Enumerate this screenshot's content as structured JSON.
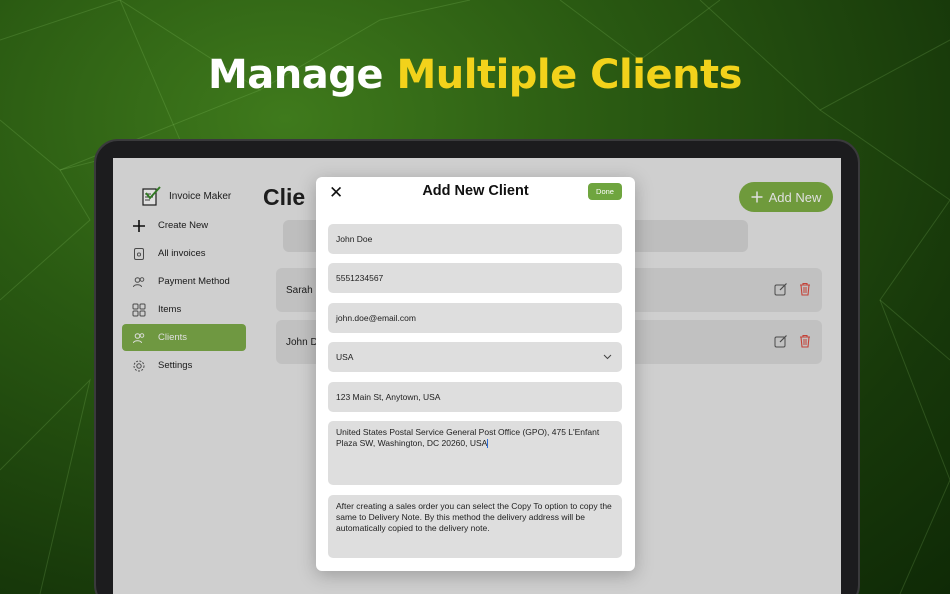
{
  "headline": {
    "part1": "Manage",
    "part2": "Multiple Clients"
  },
  "app": {
    "name": "Invoice Maker"
  },
  "sidebar": {
    "items": [
      {
        "label": "Create New",
        "icon": "plus-icon"
      },
      {
        "label": "All invoices",
        "icon": "document-icon"
      },
      {
        "label": "Payment Method",
        "icon": "users-icon"
      },
      {
        "label": "Items",
        "icon": "grid-icon"
      },
      {
        "label": "Clients",
        "icon": "users-icon",
        "active": true
      },
      {
        "label": "Settings",
        "icon": "gear-icon"
      }
    ]
  },
  "main": {
    "title": "Clie",
    "add_button": "Add New",
    "clients": [
      {
        "name": "Sarah "
      },
      {
        "name": "John D"
      }
    ]
  },
  "modal": {
    "close": "✕",
    "title": "Add New Client",
    "done": "Done",
    "fields": {
      "name": "John Doe",
      "phone": "5551234567",
      "email": "john.doe@email.com",
      "country": "USA",
      "address": "123 Main St, Anytown, USA",
      "shipping_address": "United States Postal Service General Post Office (GPO), 475 L'Enfant Plaza SW, Washington, DC 20260, USA",
      "note": "After creating a sales order you can select the Copy To option to copy the same to Delivery Note. By this method the delivery address will be automatically copied to the delivery note."
    }
  },
  "colors": {
    "accent_green": "#7fb045",
    "headline_yellow": "#f2d21b",
    "delete_red": "#e04a3f"
  }
}
